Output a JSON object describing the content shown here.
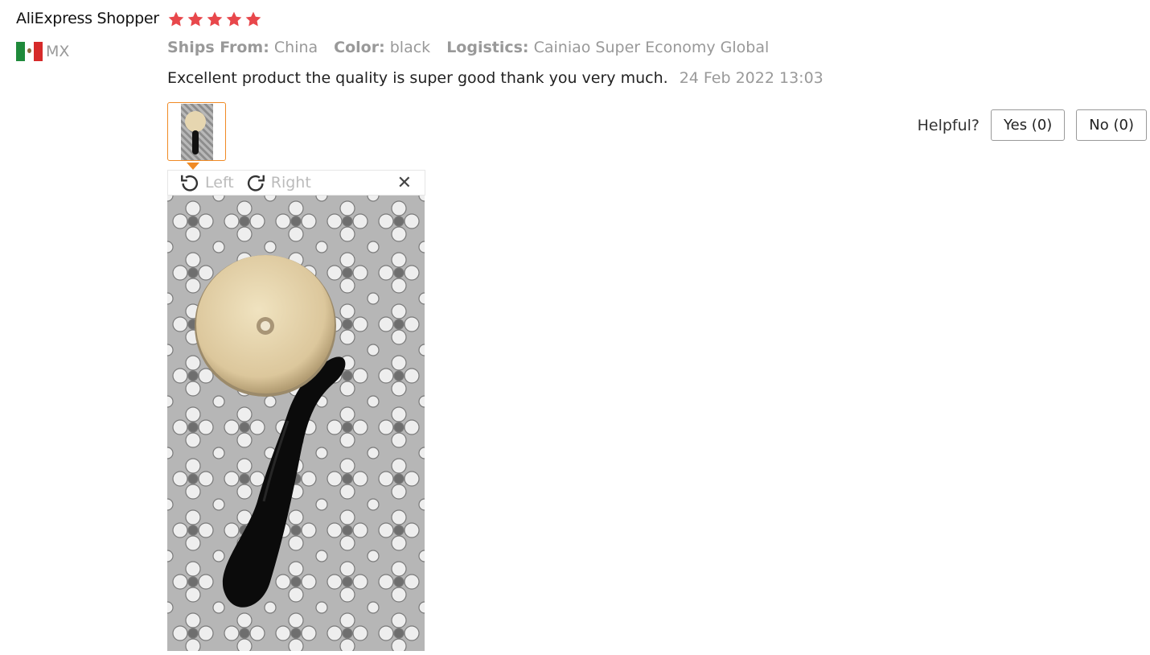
{
  "reviewer": {
    "name": "AliExpress Shopper",
    "rating": 5,
    "country_code": "MX"
  },
  "icons": {
    "star": "star-icon",
    "flag": "mexico-flag-icon",
    "rotate_left": "rotate-left-icon",
    "rotate_right": "rotate-right-icon",
    "close": "close-icon"
  },
  "meta": {
    "ships_from_label": "Ships From:",
    "ships_from_value": "China",
    "color_label": "Color:",
    "color_value": "black",
    "logistics_label": "Logistics:",
    "logistics_value": "Cainiao Super Economy Global"
  },
  "review": {
    "text": "Excellent product the quality is super good thank you very much.",
    "date": "24 Feb 2022 13:03"
  },
  "helpful": {
    "label": "Helpful?",
    "yes_label": "Yes (0)",
    "no_label": "No (0)"
  },
  "viewer": {
    "rotate_left_label": "Left",
    "rotate_right_label": "Right",
    "close_glyph": "✕"
  },
  "colors": {
    "star": "#e8474b",
    "thumb_border": "#f08a24",
    "muted_text": "#999999",
    "flag_green": "#1f8a3b",
    "flag_red": "#d62a2a"
  }
}
